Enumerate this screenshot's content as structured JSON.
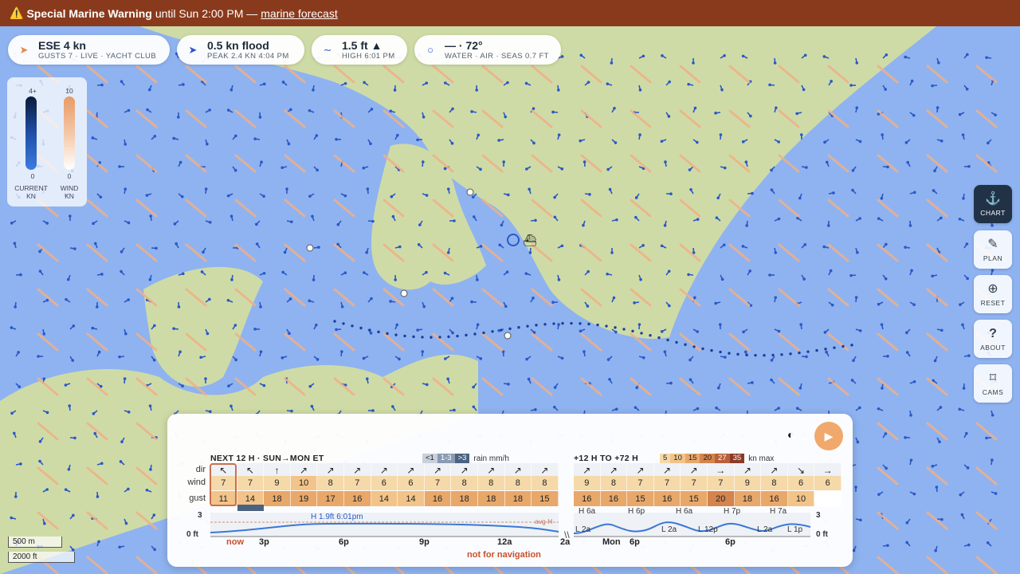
{
  "warning": {
    "icon": "warning-icon",
    "title": "Special Marine Warning",
    "text": "until Sun 2:00 PM —",
    "link": "marine forecast"
  },
  "conditions": [
    {
      "icon": "wind-arrow-icon",
      "main": "ESE 4 kn",
      "sub": "GUSTS 7 · LIVE · YACHT CLUB"
    },
    {
      "icon": "current-arrow-icon",
      "main": "0.5 kn flood",
      "sub": "PEAK 2.4 KN 4:04 PM"
    },
    {
      "icon": "tide-wave-icon",
      "main": "1.5 ft ▲",
      "sub": "HIGH 6:01 PM"
    },
    {
      "icon": "temperature-dot-icon",
      "main": "— · 72°",
      "sub": "WATER · AIR · SEAS 0.7 FT"
    }
  ],
  "legend": {
    "current": {
      "max": "4+",
      "min": "0",
      "label1": "CURRENT",
      "label2": "KN"
    },
    "wind": {
      "max": "10",
      "min": "0",
      "label1": "WIND",
      "label2": "KN"
    }
  },
  "side_buttons": [
    {
      "label": "CHART",
      "icon": "anchor-icon",
      "active": true
    },
    {
      "label": "PLAN",
      "icon": "pencil-icon",
      "active": false
    },
    {
      "label": "RESET",
      "icon": "crosshair-icon",
      "active": false
    },
    {
      "label": "ABOUT",
      "icon": "question-icon",
      "active": false
    },
    {
      "label": "CAMS",
      "icon": "camera-frame-icon",
      "active": false
    }
  ],
  "scale": {
    "metric": "500 m",
    "imperial": "2000 ft"
  },
  "forecast": {
    "near_title": "NEXT 12 H · SUN→MON ET",
    "rain_key": [
      "<1",
      "1-3",
      ">3"
    ],
    "rain_label": "rain mm/h",
    "far_title": "+12 H TO +72 H",
    "wind_key": [
      "5",
      "10",
      "15",
      "20",
      "27",
      "35"
    ],
    "wind_key_label": "kn max",
    "row_labels": {
      "dir": "dir",
      "wind": "wind",
      "gust": "gust"
    },
    "near": {
      "dir": [
        "↖",
        "↖",
        "↑",
        "↗",
        "↗",
        "↗",
        "↗",
        "↗",
        "↗",
        "↗",
        "↗",
        "↗",
        "↗"
      ],
      "wind": [
        "7",
        "7",
        "9",
        "10",
        "8",
        "7",
        "6",
        "6",
        "7",
        "8",
        "8",
        "8",
        "8"
      ],
      "gust": [
        "11",
        "14",
        "18",
        "19",
        "17",
        "16",
        "14",
        "14",
        "16",
        "18",
        "18",
        "18",
        "15"
      ]
    },
    "far": {
      "dir": [
        "↗",
        "↗",
        "↗",
        "↗",
        "↗",
        "→",
        "↗",
        "↗",
        "↘",
        "→"
      ],
      "wind": [
        "9",
        "8",
        "7",
        "7",
        "7",
        "7",
        "9",
        "8",
        "6",
        "6"
      ],
      "gust": [
        "16",
        "16",
        "15",
        "16",
        "15",
        "20",
        "18",
        "16",
        "10",
        ""
      ]
    },
    "tide": {
      "y_max": "3",
      "y_min": "0 ft",
      "y_max_right": "3",
      "y_min_right": "0 ft",
      "peak_label": "H 1.9ft 6:01pm",
      "avg_label": "avg H",
      "far_highs": [
        "H 6a",
        "H 6p",
        "H 6a",
        "H 7p",
        "H 7a"
      ],
      "far_lows": [
        "L 2a",
        "L 2a",
        "L 12p",
        "L 2a",
        "L 1p"
      ]
    },
    "near_ticks": [
      "now",
      "3p",
      "6p",
      "9p",
      "12a",
      "2a"
    ],
    "far_ticks": [
      "Mon",
      "6p",
      "6p"
    ],
    "footer": "not for navigation"
  },
  "colors": {
    "water": "#8fb3f0",
    "land": "#cfdba6",
    "warning_bg": "#8a3a1c",
    "current_arrow": "#2a58c8",
    "wind_arrow": "#f0b088",
    "play": "#f0a86c"
  }
}
